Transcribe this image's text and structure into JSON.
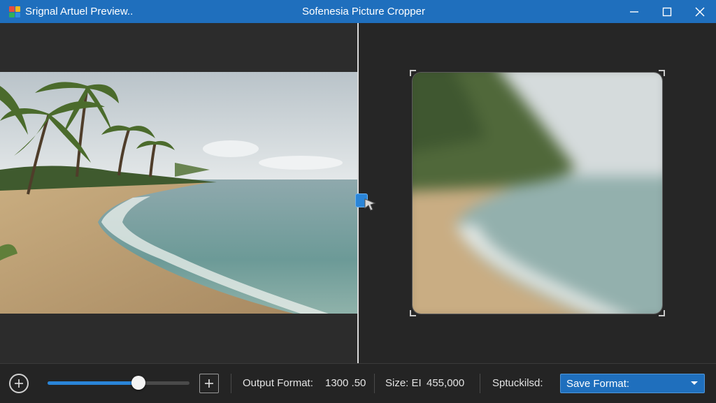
{
  "window": {
    "left_title": "Srignal Artuel Preview..",
    "title": "Sofenesia Picture Cropper",
    "controls": [
      "minimize",
      "maximize",
      "close"
    ]
  },
  "icons": {
    "app": "app-grid-icon",
    "minimize": "minimize-icon",
    "maximize": "maximize-icon",
    "close": "close-icon",
    "zoom_out": "plus-circle-icon",
    "zoom_in": "plus-square-icon",
    "dropdown": "chevron-down-icon",
    "cursor": "pointer-cursor-icon"
  },
  "toolbar": {
    "zoom_slider_value": 0.64,
    "output_format_label": "Output Format:",
    "output_format_value": "1300 .50",
    "size_label": "Size: EI",
    "size_value": "455,000",
    "status_label": "Sptuckilsd:",
    "save_format_value": "Save Format:"
  },
  "colors": {
    "accent": "#1f6fbd",
    "titlebar": "#1f6fbd",
    "background": "#232323",
    "slider_fill": "#2a85d8"
  }
}
